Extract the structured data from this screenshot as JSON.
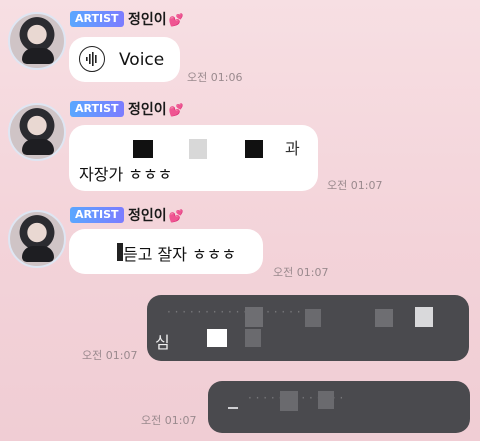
{
  "messages": [
    {
      "badge": "ARTIST",
      "sender": "정인이",
      "voice_label": "Voice",
      "time": "오전 01:06"
    },
    {
      "badge": "ARTIST",
      "sender": "정인이",
      "line1_suffix": "과",
      "line2": "자장가 ㅎㅎㅎ",
      "time": "오전 01:07"
    },
    {
      "badge": "ARTIST",
      "sender": "정인이",
      "text": "듣고 잘자 ㅎㅎㅎ",
      "time": "오전 01:07"
    }
  ],
  "replies": [
    {
      "line2_prefix": "심",
      "time": "오전 01:07"
    },
    {
      "time": "오전 01:07"
    }
  ],
  "colors": {
    "badge_start": "#5aa7ff",
    "badge_end": "#7c7cff",
    "heart": "#ff4fa3",
    "reply_bubble": "#4a4a4e",
    "background": "#f3d3d9"
  },
  "icons": {
    "heart": "two-hearts",
    "voice": "sound-wave"
  }
}
